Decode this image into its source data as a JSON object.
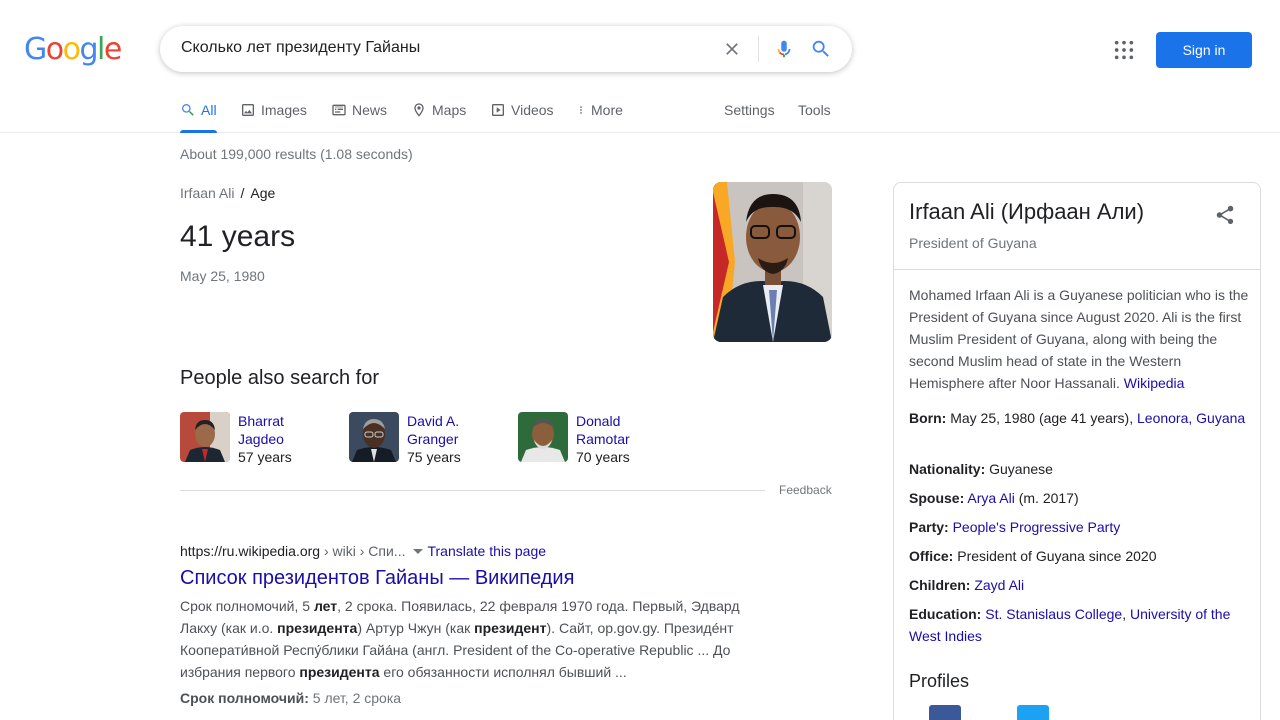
{
  "logo": [
    "G",
    "o",
    "o",
    "g",
    "l",
    "e"
  ],
  "search": {
    "query": "Сколько лет президенту Гайаны"
  },
  "header": {
    "signin_label": "Sign in"
  },
  "tabs": [
    {
      "label": "All",
      "icon": "search-icon",
      "active": true
    },
    {
      "label": "Images",
      "icon": "image-icon"
    },
    {
      "label": "News",
      "icon": "news-icon"
    },
    {
      "label": "Maps",
      "icon": "map-pin-icon"
    },
    {
      "label": "Videos",
      "icon": "video-icon"
    },
    {
      "label": "More",
      "icon": "more-vert-icon"
    },
    {
      "label": "Settings"
    },
    {
      "label": "Tools"
    }
  ],
  "stats": "About 199,000 results (1.08 seconds)",
  "answer": {
    "crumb_entity": "Irfaan Ali",
    "crumb_sep": "/",
    "crumb_attr": "Age",
    "value": "41 years",
    "date": "May 25, 1980"
  },
  "pasf": {
    "title": "People also search for",
    "people": [
      {
        "name": "Bharrat Jagdeo",
        "years": "57 years"
      },
      {
        "name": "David A. Granger",
        "years": "75 years"
      },
      {
        "name": "Donald Ramotar",
        "years": "70 years"
      }
    ]
  },
  "feedback": "Feedback",
  "result": {
    "url": "https://ru.wikipedia.org",
    "path": " › wiki › Спи...",
    "translate": "Translate this page",
    "title": "Список президентов Гайаны — Википедия",
    "snippet_html": "Срок полномочий, 5 <b>лет</b>, 2 срока. Появилась, 22 февраля 1970 года. Первый, Эдвард Лакху (как и.о. <b>президента</b>) Артур Чжун (как <b>президент</b>). Сайт, op.gov.gy. Президе́нт Кооперати́вной Респу́блики Гайа́на (англ. President of the Co-operative Republic ... До избрания первого <b>президента</b> его обязанности исполнял бывший ...",
    "extra_label": "Срок полномочий:",
    "extra_value": "5 лет, 2 срока"
  },
  "kp": {
    "title": "Irfaan Ali (Ирфаан Али)",
    "subtitle": "President of Guyana",
    "description": "Mohamed Irfaan Ali is a Guyanese politician who is the President of Guyana since August 2020. Ali is the first Muslim President of Guyana, along with being the second Muslim head of state in the Western Hemisphere after Noor Hassanali.",
    "description_source": "Wikipedia",
    "facts": {
      "born_label": "Born:",
      "born_value": "May 25, 1980 (age 41 years),",
      "born_link1": "Leonora,",
      "born_link2": "Guyana",
      "nationality_label": "Nationality:",
      "nationality_value": "Guyanese",
      "spouse_label": "Spouse:",
      "spouse_link": "Arya Ali",
      "spouse_value": "(m. 2017)",
      "party_label": "Party:",
      "party_link": "People's Progressive Party",
      "office_label": "Office:",
      "office_value": "President of Guyana since 2020",
      "children_label": "Children:",
      "children_link": "Zayd Ali",
      "education_label": "Education:",
      "education_link1": "St. Stanislaus College",
      "education_sep": ",",
      "education_link2": "University of the West Indies"
    },
    "profiles_title": "Profiles"
  }
}
